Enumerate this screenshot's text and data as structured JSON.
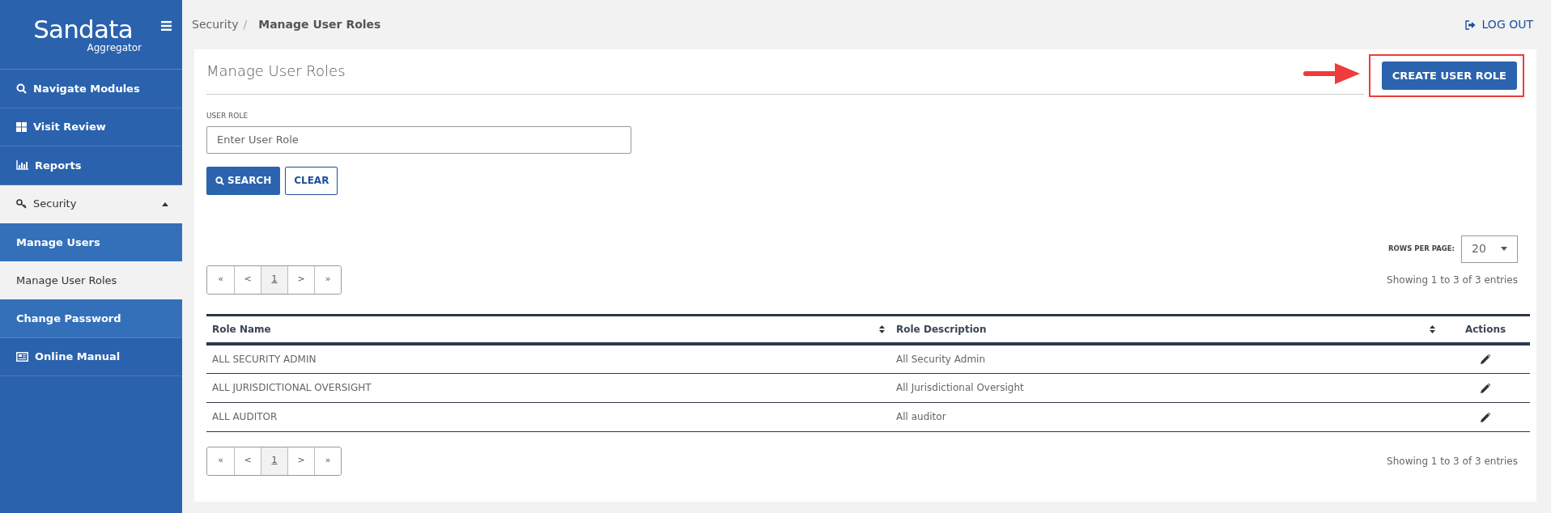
{
  "sidebar": {
    "logo": {
      "name": "Sandata",
      "subtitle": "Aggregator"
    },
    "items": [
      {
        "label": "Navigate Modules",
        "highlighted": false
      },
      {
        "label": "Visit Review",
        "highlighted": false
      },
      {
        "label": "Reports",
        "highlighted": false
      },
      {
        "label": "Security",
        "expanded": true,
        "children": [
          {
            "label": "Manage Users",
            "selected": false
          },
          {
            "label": "Manage User Roles",
            "selected": true
          }
        ]
      },
      {
        "label": "Change Password",
        "highlighted": true
      },
      {
        "label": "Online Manual",
        "highlighted": false
      }
    ]
  },
  "breadcrumb": {
    "items": [
      "Security",
      "Manage User Roles"
    ],
    "separator": "/"
  },
  "logout": "LOG OUT",
  "page": {
    "title": "Manage User Roles",
    "create_button": "CREATE USER ROLE",
    "filter": {
      "label": "USER ROLE",
      "placeholder": "Enter User Role"
    },
    "buttons": [
      {
        "label": "SEARCH",
        "kind": "primary"
      },
      {
        "label": "CLEAR",
        "kind": "outline"
      }
    ],
    "rows_per_page": {
      "label": "ROWS PER PAGE:",
      "value": "20"
    },
    "pagination_top": [
      {
        "label": "«",
        "selected": false
      },
      {
        "label": "<",
        "selected": false
      },
      {
        "label": "1",
        "selected": true
      },
      {
        "label": ">",
        "selected": false
      },
      {
        "label": "»",
        "selected": false
      }
    ],
    "summary_top": "Showing 1 to 3 of 3 entries",
    "table": {
      "columns": [
        {
          "label": "Role Name",
          "sortable": true
        },
        {
          "label": "Role Description",
          "sortable": true
        },
        {
          "label": "Actions",
          "sortable": false
        }
      ],
      "rows": [
        {
          "cells": [
            "ALL SECURITY ADMIN",
            "All Security Admin"
          ]
        },
        {
          "cells": [
            "ALL JURISDICTIONAL OVERSIGHT",
            "All Jurisdictional Oversight"
          ]
        },
        {
          "cells": [
            "ALL AUDITOR",
            "All auditor"
          ]
        }
      ]
    },
    "pagination_bottom": [
      {
        "label": "«",
        "selected": false
      },
      {
        "label": "<",
        "selected": false
      },
      {
        "label": "1",
        "selected": true
      },
      {
        "label": ">",
        "selected": false
      },
      {
        "label": "»",
        "selected": false
      }
    ],
    "summary_bottom": "Showing 1 to 3 of 3 entries"
  }
}
